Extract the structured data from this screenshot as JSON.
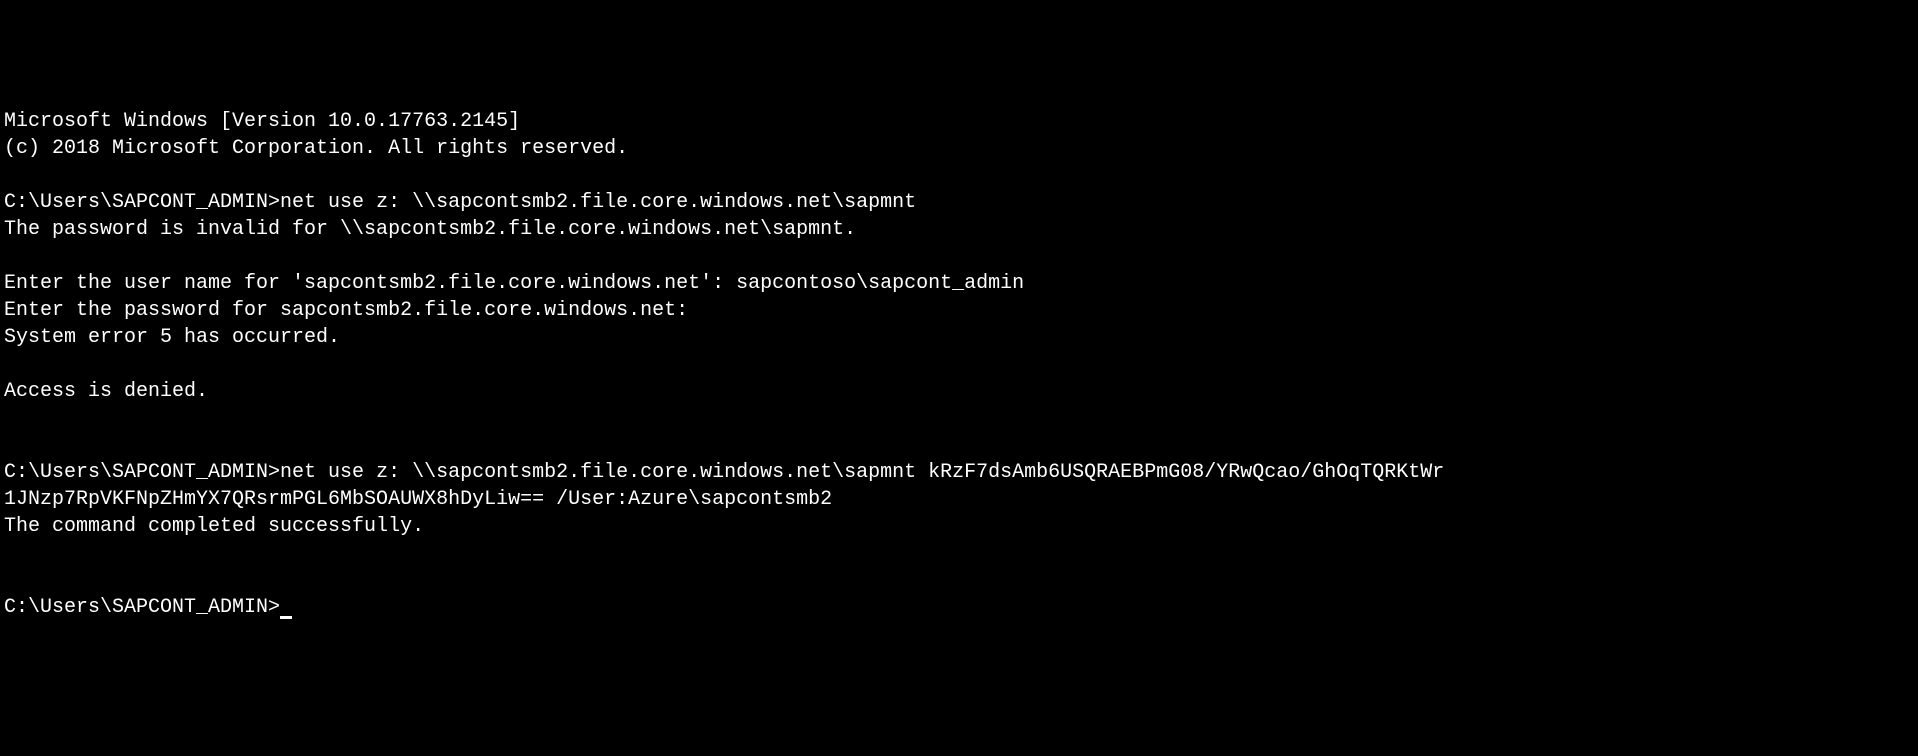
{
  "terminal": {
    "header_line1": "Microsoft Windows [Version 10.0.17763.2145]",
    "header_line2": "(c) 2018 Microsoft Corporation. All rights reserved.",
    "blank": "",
    "prompt1_path": "C:\\Users\\SAPCONT_ADMIN>",
    "cmd1": "net use z: \\\\sapcontsmb2.file.core.windows.net\\sapmnt",
    "cmd1_out1": "The password is invalid for \\\\sapcontsmb2.file.core.windows.net\\sapmnt.",
    "cmd1_out2": "Enter the user name for 'sapcontsmb2.file.core.windows.net': sapcontoso\\sapcont_admin",
    "cmd1_out3": "Enter the password for sapcontsmb2.file.core.windows.net:",
    "cmd1_out4": "System error 5 has occurred.",
    "cmd1_out5": "Access is denied.",
    "prompt2_path": "C:\\Users\\SAPCONT_ADMIN>",
    "cmd2_line1": "net use z: \\\\sapcontsmb2.file.core.windows.net\\sapmnt kRzF7dsAmb6USQRAEBPmG08/YRwQcao/GhOqTQRKtWr",
    "cmd2_line2": "1JNzp7RpVKFNpZHmYX7QRsrmPGL6MbSOAUWX8hDyLiw== /User:Azure\\sapcontsmb2",
    "cmd2_out1": "The command completed successfully.",
    "prompt3_path": "C:\\Users\\SAPCONT_ADMIN>"
  }
}
